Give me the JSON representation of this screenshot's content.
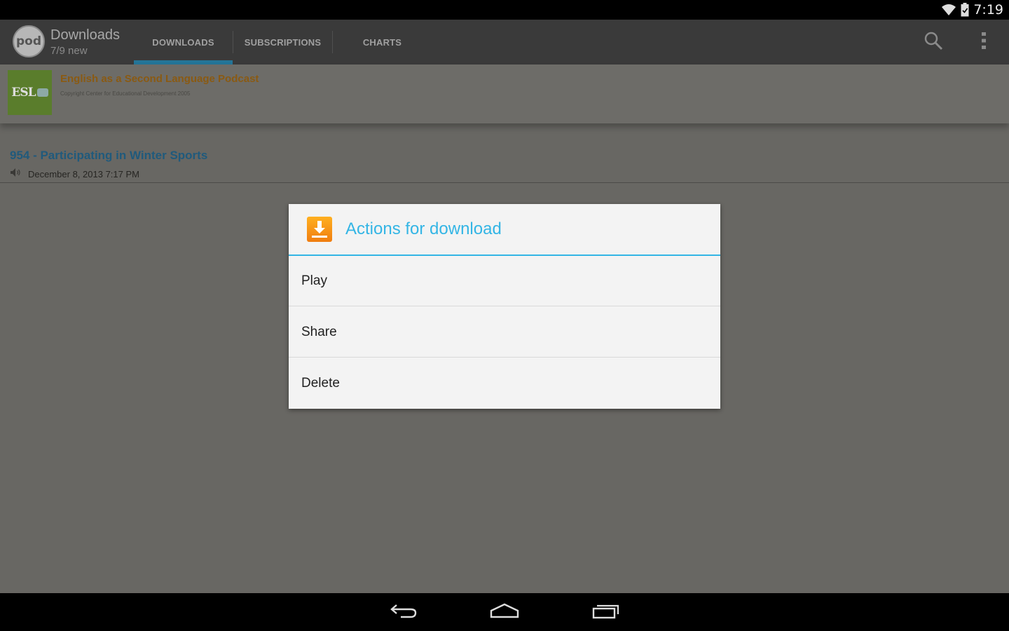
{
  "status_bar": {
    "time": "7:19",
    "icons": [
      "wifi-icon",
      "battery-icon"
    ]
  },
  "action_bar": {
    "app_logo_text": "pod",
    "title": "Downloads",
    "subtitle": "7/9 new",
    "tabs": [
      {
        "label": "DOWNLOADS",
        "selected": true
      },
      {
        "label": "SUBSCRIPTIONS",
        "selected": false
      },
      {
        "label": "CHARTS",
        "selected": false
      }
    ],
    "actions": [
      "search-icon",
      "overflow-menu-icon"
    ]
  },
  "podcast": {
    "thumb_text": "ESL",
    "title": "English as a Second Language Podcast",
    "copyright": "Copyright Center for Educational Development 2005"
  },
  "episodes": [
    {
      "title": "954 - Participating in Winter Sports",
      "date": "December 8, 2013 7:17 PM",
      "icon": "audio-icon"
    }
  ],
  "dialog": {
    "icon": "download-icon",
    "title": "Actions for download",
    "items": [
      {
        "label": "Play"
      },
      {
        "label": "Share"
      },
      {
        "label": "Delete"
      }
    ]
  },
  "nav_bar": {
    "buttons": [
      "back-icon",
      "home-icon",
      "recents-icon"
    ]
  },
  "colors": {
    "accent": "#33b5e5",
    "tab_indicator": "#1e8ab8",
    "podcast_title": "#e8961c"
  }
}
